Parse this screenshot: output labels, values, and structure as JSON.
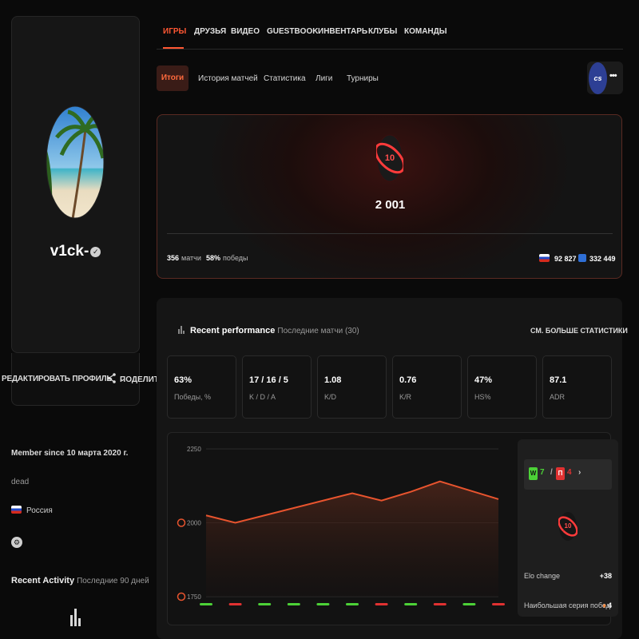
{
  "profile": {
    "username": "v1ck-",
    "edit_label": "РЕДАКТИРОВАТЬ ПРОФИЛЬ",
    "share_label": "ПОДЕЛИТЬ",
    "member_since": "Member since 10 марта 2020 г.",
    "bio": "dead",
    "country": "Россия",
    "recent_activity_title": "Recent Activity",
    "recent_activity_sub": "Последние 90 дней"
  },
  "topnav": [
    "ИГРЫ",
    "ДРУЗЬЯ",
    "ВИДЕО",
    "GUESTBOOK",
    "ИНВЕНТАРЬ",
    "КЛУБЫ",
    "КОМАНДЫ"
  ],
  "subnav": [
    "Итоги",
    "История матчей",
    "Статистика",
    "Лиги",
    "Турниры"
  ],
  "game_badge": {
    "logo": "cs",
    "more": "•••"
  },
  "elo": {
    "level": "10",
    "value": "2 001",
    "matches": "356",
    "matches_label": "матчи",
    "wins_pct": "58%",
    "wins_label": "победы",
    "country_rank": "92 827",
    "region_rank": "332 449"
  },
  "performance": {
    "title": "Recent performance",
    "subtitle": "Последние матчи (30)",
    "more_label": "СМ. БОЛЬШЕ СТАТИСТИКИ",
    "stats": [
      {
        "value": "63%",
        "label": "Победы, %"
      },
      {
        "value": "17 / 16 / 5",
        "label": "K / D / A"
      },
      {
        "value": "1.08",
        "label": "K/D"
      },
      {
        "value": "0.76",
        "label": "K/R"
      },
      {
        "value": "47%",
        "label": "HS%"
      },
      {
        "value": "87.1",
        "label": "ADR"
      }
    ]
  },
  "chart_data": {
    "type": "area",
    "y_ticks": [
      "2250",
      "2000",
      "1750"
    ],
    "ylim": [
      1750,
      2250
    ],
    "values": [
      2025,
      2000,
      2025,
      2050,
      2075,
      2100,
      2075,
      2105,
      2140,
      2110,
      2080
    ],
    "results": [
      "W",
      "L",
      "W",
      "W",
      "W",
      "W",
      "L",
      "W",
      "L",
      "W",
      "L"
    ],
    "colors": {
      "line": "#e8542e",
      "win": "#4cd137",
      "loss": "#e03131"
    }
  },
  "side_panel": {
    "wins": "7",
    "losses": "4",
    "win_letter": "W",
    "loss_letter": "П",
    "level": "10",
    "elo_change_label": "Elo change",
    "elo_change_value": "+38",
    "streak_label": "Наибольшая серия побед",
    "streak_value": "4"
  },
  "colors": {
    "accent": "#ff5733",
    "win": "#4cd137",
    "loss": "#e03131"
  }
}
